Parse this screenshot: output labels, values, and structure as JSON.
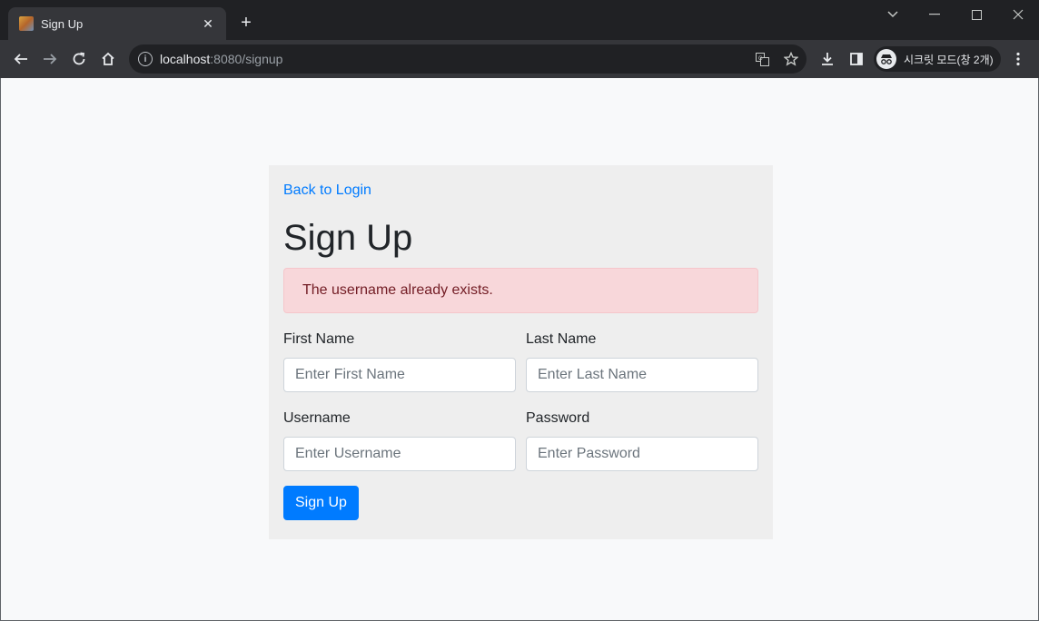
{
  "browser": {
    "tab_title": "Sign Up",
    "tab_close": "✕",
    "new_tab": "+",
    "url_host": "localhost",
    "url_rest": ":8080/signup",
    "incognito_label": "시크릿 모드(창 2개)",
    "icons": [
      "back-icon",
      "forward-icon",
      "reload-icon",
      "home-icon",
      "info-icon",
      "translate-icon",
      "star-icon",
      "download-icon",
      "sidepanel-icon",
      "incognito-icon",
      "menu-icon",
      "minimize-icon",
      "maximize-icon",
      "close-icon",
      "tab-search-icon"
    ]
  },
  "page": {
    "back_link": "Back to Login",
    "heading": "Sign Up",
    "alert": "The username already exists.",
    "fields": {
      "first_name": {
        "label": "First Name",
        "placeholder": "Enter First Name"
      },
      "last_name": {
        "label": "Last Name",
        "placeholder": "Enter Last Name"
      },
      "username": {
        "label": "Username",
        "placeholder": "Enter Username"
      },
      "password": {
        "label": "Password",
        "placeholder": "Enter Password"
      }
    },
    "submit": "Sign Up"
  },
  "colors": {
    "link": "#007bff",
    "button": "#007bff",
    "alert_bg": "#f8d7da",
    "alert_text": "#721c24",
    "card_bg": "#eeeeee"
  }
}
